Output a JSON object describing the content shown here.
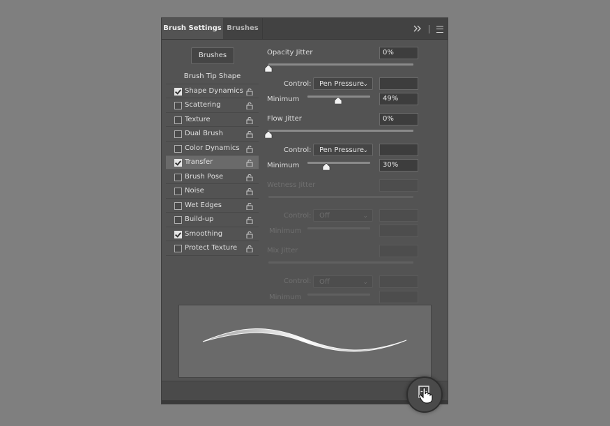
{
  "tabs": [
    {
      "label": "Brush Settings",
      "active": true
    },
    {
      "label": "Brushes",
      "active": false
    }
  ],
  "icons": {
    "panel_menu": "hamburger-menu-icon",
    "collapse": "double-chevron-right-icon",
    "lock": "lock-icon",
    "new_preset": "new-preset-icon",
    "cursor": "hand-cursor-icon"
  },
  "brushes_button": "Brushes",
  "brush_tip_shape": "Brush Tip Shape",
  "options": [
    {
      "label": "Shape Dynamics",
      "checked": true
    },
    {
      "label": "Scattering",
      "checked": false
    },
    {
      "label": "Texture",
      "checked": false
    },
    {
      "label": "Dual Brush",
      "checked": false
    },
    {
      "label": "Color Dynamics",
      "checked": false
    },
    {
      "label": "Transfer",
      "checked": true,
      "selected": true
    },
    {
      "label": "Brush Pose",
      "checked": false
    },
    {
      "label": "Noise",
      "checked": false
    },
    {
      "label": "Wet Edges",
      "checked": false
    },
    {
      "label": "Build-up",
      "checked": false
    },
    {
      "label": "Smoothing",
      "checked": true
    },
    {
      "label": "Protect Texture",
      "checked": false
    }
  ],
  "transfer": {
    "opacity_jitter": {
      "label": "Opacity Jitter",
      "value": "0%",
      "slider": 0
    },
    "opacity_control": {
      "label": "Control:",
      "value": "Pen Pressure"
    },
    "opacity_minimum": {
      "label": "Minimum",
      "value": "49%",
      "slider": 0.49
    },
    "flow_jitter": {
      "label": "Flow Jitter",
      "value": "0%",
      "slider": 0
    },
    "flow_control": {
      "label": "Control:",
      "value": "Pen Pressure"
    },
    "flow_minimum": {
      "label": "Minimum",
      "value": "30%",
      "slider": 0.3
    },
    "wetness_jitter": {
      "label": "Wetness Jitter",
      "value": ""
    },
    "wetness_control": {
      "label": "Control:",
      "value": "Off"
    },
    "wetness_minimum": {
      "label": "Minimum",
      "value": ""
    },
    "mix_jitter": {
      "label": "Mix Jitter",
      "value": ""
    },
    "mix_control": {
      "label": "Control:",
      "value": "Off"
    },
    "mix_minimum": {
      "label": "Minimum",
      "value": ""
    }
  },
  "colors": {
    "panel": "#535353",
    "background": "#7f7f7f",
    "tabbar": "#424242",
    "selected_row": "#6a6a6a",
    "preview": "#6a6a6a"
  }
}
